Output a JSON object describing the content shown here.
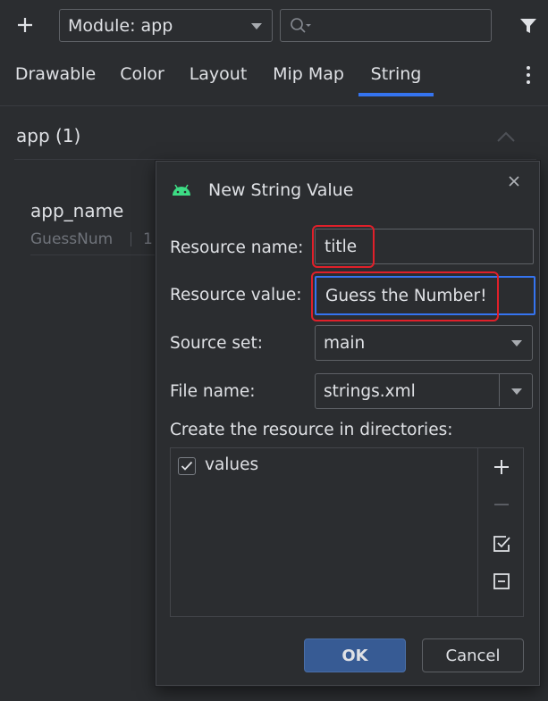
{
  "toolbar": {
    "module_label": "Module: app",
    "search_placeholder": ""
  },
  "tabs": [
    {
      "label": "Drawable"
    },
    {
      "label": "Color"
    },
    {
      "label": "Layout"
    },
    {
      "label": "Mip Map"
    },
    {
      "label": "String",
      "selected": true
    }
  ],
  "resources": {
    "group_label": "app (1)",
    "items": [
      {
        "name": "app_name",
        "preview": "GuessNum",
        "count": "1"
      }
    ]
  },
  "dialog": {
    "title": "New String Value",
    "resource_name_label": "Resource name:",
    "resource_name_value": "title",
    "resource_value_label": "Resource value:",
    "resource_value_value": "Guess the Number!",
    "source_set_label": "Source set:",
    "source_set_value": "main",
    "file_name_label": "File name:",
    "file_name_value": "strings.xml",
    "directories_label": "Create the resource in directories:",
    "directories": [
      {
        "label": "values",
        "checked": true
      }
    ],
    "ok_label": "OK",
    "cancel_label": "Cancel"
  },
  "colors": {
    "background": "#2b2d30",
    "accent": "#3574f0",
    "highlight": "#e0202a",
    "android": "#3ddc84"
  }
}
